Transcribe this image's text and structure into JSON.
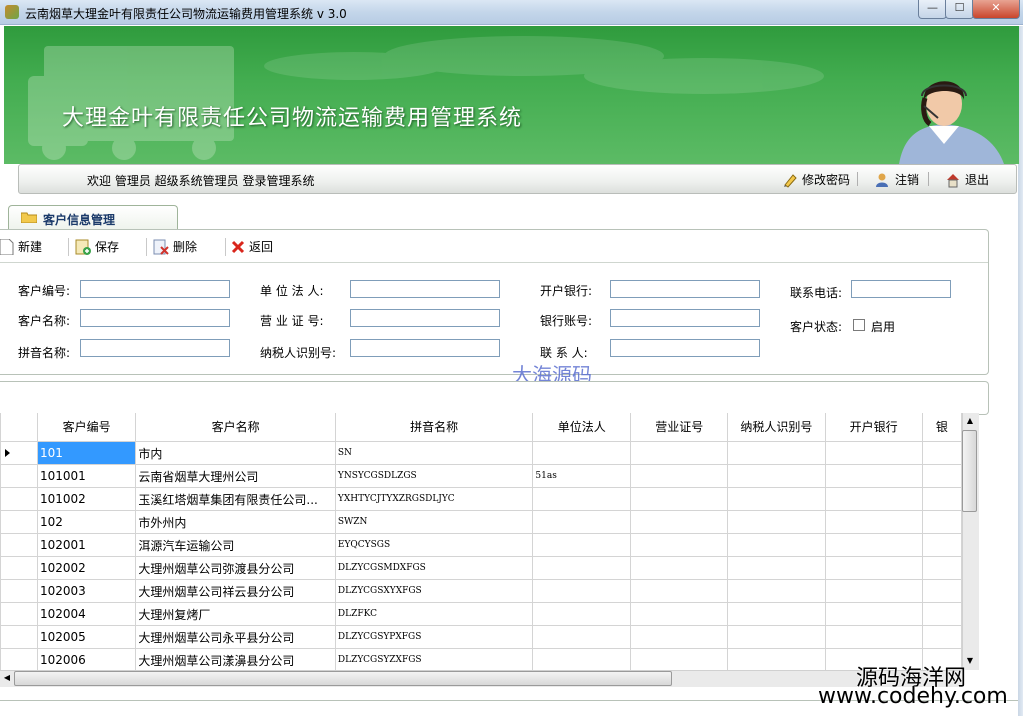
{
  "window": {
    "title": "云南烟草大理金叶有限责任公司物流运输费用管理系统 v 3.0",
    "min_glyph": "—",
    "max_glyph": "☐",
    "close_glyph": "✕"
  },
  "banner": {
    "title": "大理金叶有限责任公司物流运输费用管理系统"
  },
  "welcome": {
    "text": "欢迎 管理员  超级系统管理员  登录管理系统",
    "change_password": "修改密码",
    "logout": "注销",
    "exit": "退出"
  },
  "tab": {
    "label": "客户信息管理"
  },
  "toolbar": {
    "new": "新建",
    "save": "保存",
    "delete": "删除",
    "back": "返回"
  },
  "form": {
    "customer_code": "客户编号:",
    "customer_name": "客户名称:",
    "pinyin_name": "拼音名称:",
    "legal_person": "单 位 法 人:",
    "business_license": "营 业 证 号:",
    "taxpayer_id": "纳税人识别号:",
    "bank": "开户银行:",
    "bank_account": "银行账号:",
    "contact_person": "联 系 人:",
    "phone": "联系电话:",
    "status": "客户状态:",
    "enabled": "启用",
    "enabled_checked": false
  },
  "watermarks": {
    "center": "大海源码",
    "br_line1": "源码海洋网",
    "br_line2": "www.codehy.com"
  },
  "grid": {
    "columns": [
      "客户编号",
      "客户名称",
      "拼音名称",
      "单位法人",
      "营业证号",
      "纳税人识别号",
      "开户银行",
      "银"
    ],
    "rows": [
      {
        "code": "101",
        "name": "市内",
        "pinyin": "SN",
        "legal": "",
        "selected": true
      },
      {
        "code": "101001",
        "name": "云南省烟草大理州公司",
        "pinyin": "YNSYCGSDLZGS",
        "legal": "51as",
        "selected": false
      },
      {
        "code": "101002",
        "name": "玉溪红塔烟草集团有限责任公司...",
        "pinyin": "YXHTYCJTYXZRGSDLJYC",
        "legal": "",
        "selected": false
      },
      {
        "code": "102",
        "name": "市外州内",
        "pinyin": "SWZN",
        "legal": "",
        "selected": false
      },
      {
        "code": "102001",
        "name": "洱源汽车运输公司",
        "pinyin": "EYQCYSGS",
        "legal": "",
        "selected": false
      },
      {
        "code": "102002",
        "name": "大理州烟草公司弥渡县分公司",
        "pinyin": "DLZYCGSMDXFGS",
        "legal": "",
        "selected": false
      },
      {
        "code": "102003",
        "name": "大理州烟草公司祥云县分公司",
        "pinyin": "DLZYCGSXYXFGS",
        "legal": "",
        "selected": false
      },
      {
        "code": "102004",
        "name": "大理州复烤厂",
        "pinyin": "DLZFKC",
        "legal": "",
        "selected": false
      },
      {
        "code": "102005",
        "name": "大理州烟草公司永平县分公司",
        "pinyin": "DLZYCGSYPXFGS",
        "legal": "",
        "selected": false
      },
      {
        "code": "102006",
        "name": "大理州烟草公司漾濞县分公司",
        "pinyin": "DLZYCGSYZXFGS",
        "legal": "",
        "selected": false
      }
    ]
  }
}
